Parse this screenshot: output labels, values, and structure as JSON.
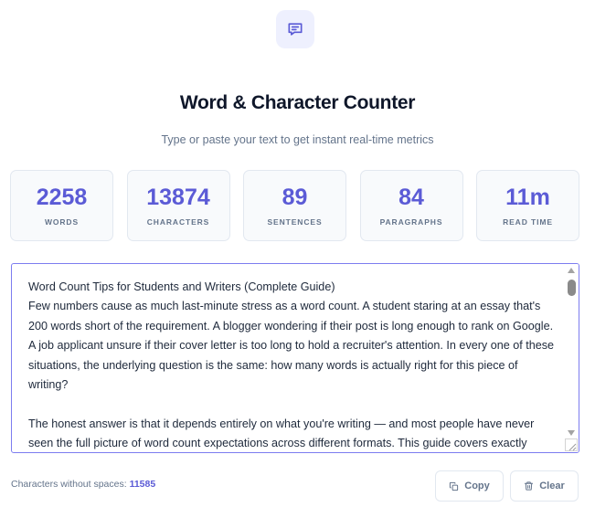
{
  "header": {
    "logo_icon": "chat-bubble-icon",
    "title": "Word & Character Counter",
    "subtitle": "Type or paste your text to get instant real-time metrics"
  },
  "stats": [
    {
      "value": "2258",
      "label": "WORDS"
    },
    {
      "value": "13874",
      "label": "CHARACTERS"
    },
    {
      "value": "89",
      "label": "SENTENCES"
    },
    {
      "value": "84",
      "label": "PARAGRAPHS"
    },
    {
      "value": "11m",
      "label": "READ TIME"
    }
  ],
  "editor": {
    "text": "Word Count Tips for Students and Writers (Complete Guide)\nFew numbers cause as much last-minute stress as a word count. A student staring at an essay that's 200 words short of the requirement. A blogger wondering if their post is long enough to rank on Google. A job applicant unsure if their cover letter is too long to hold a recruiter's attention. In every one of these situations, the underlying question is the same: how many words is actually right for this piece of writing?\n\nThe honest answer is that it depends entirely on what you're writing — and most people have never seen the full picture of word count expectations across different formats. This guide covers exactly"
  },
  "footer": {
    "chars_no_spaces_label": "Characters without spaces:",
    "chars_no_spaces_value": "11585"
  },
  "actions": {
    "copy_label": "Copy",
    "copy_icon": "copy-icon",
    "clear_label": "Clear",
    "clear_icon": "trash-icon"
  },
  "colors": {
    "accent": "#5b5bd6",
    "muted_text": "#64748b",
    "title_text": "#0f172a",
    "card_bg": "#f8fafc",
    "card_border": "#e2e8f0",
    "logo_bg": "#eef0fe"
  }
}
